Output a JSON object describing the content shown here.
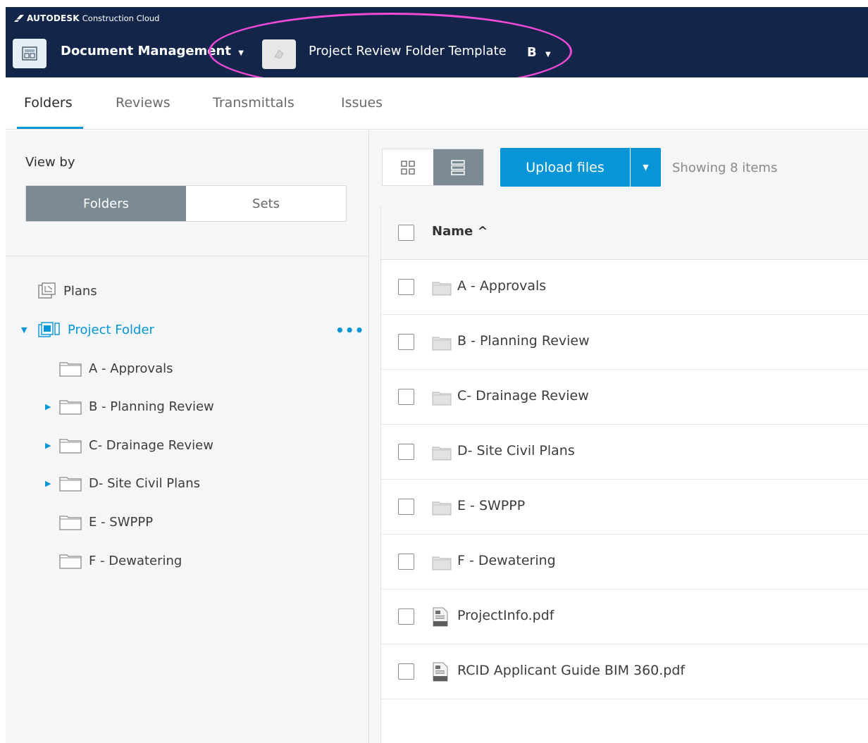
{
  "brand": {
    "name": "AUTODESK",
    "product": "Construction Cloud"
  },
  "header": {
    "module": "Document Management",
    "project": "Project Review Folder Template",
    "project_letter": "B"
  },
  "tabs": [
    {
      "label": "Folders",
      "active": true
    },
    {
      "label": "Reviews",
      "active": false
    },
    {
      "label": "Transmittals",
      "active": false
    },
    {
      "label": "Issues",
      "active": false
    }
  ],
  "sidebar": {
    "view_by_label": "View by",
    "toggle": [
      {
        "label": "Folders",
        "active": true
      },
      {
        "label": "Sets",
        "active": false
      }
    ],
    "tree": [
      {
        "label": "Plans",
        "icon": "plans-icon"
      },
      {
        "label": "Project Folder",
        "icon": "project-folder-icon",
        "expanded": true,
        "selected": true
      },
      {
        "label": "A - Approvals",
        "icon": "folder-icon"
      },
      {
        "label": "B - Planning Review",
        "icon": "folder-icon",
        "has_children": true
      },
      {
        "label": "C- Drainage Review",
        "icon": "folder-icon",
        "has_children": true
      },
      {
        "label": "D- Site Civil Plans",
        "icon": "folder-icon",
        "has_children": true
      },
      {
        "label": "E - SWPPP",
        "icon": "folder-icon"
      },
      {
        "label": "F - Dewatering",
        "icon": "folder-icon"
      }
    ]
  },
  "toolbar": {
    "upload_label": "Upload files",
    "showing_text": "Showing 8 items"
  },
  "table": {
    "name_header": "Name ^",
    "rows": [
      {
        "name": "A - Approvals",
        "type": "folder"
      },
      {
        "name": "B - Planning Review",
        "type": "folder"
      },
      {
        "name": "C- Drainage Review",
        "type": "folder"
      },
      {
        "name": "D- Site Civil Plans",
        "type": "folder"
      },
      {
        "name": "E - SWPPP",
        "type": "folder"
      },
      {
        "name": "F - Dewatering",
        "type": "folder"
      },
      {
        "name": "ProjectInfo.pdf",
        "type": "pdf"
      },
      {
        "name": "RCID Applicant Guide BIM 360.pdf",
        "type": "pdf"
      }
    ]
  },
  "colors": {
    "topbar": "#13264a",
    "accent": "#0696d7",
    "highlight": "#f04ad6",
    "toggle_active": "#7c8a93"
  }
}
